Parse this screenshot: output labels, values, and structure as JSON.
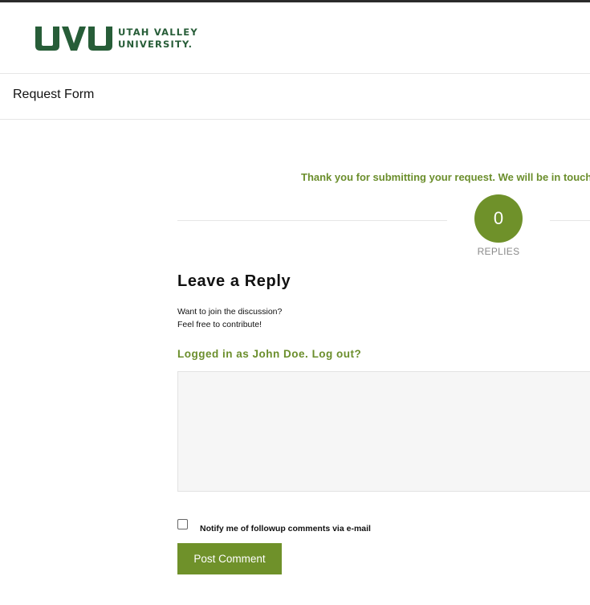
{
  "brand": {
    "logo_mark": "UVU",
    "logo_line1": "UTAH VALLEY",
    "logo_line2": "UNIVERSITY.",
    "color": "#275d38"
  },
  "page": {
    "title": "Request Form"
  },
  "main": {
    "thank_you": "Thank you for submitting your request. We will be in touch",
    "reply_count": "0",
    "reply_count_label": "REPLIES",
    "reply_heading": "Leave a Reply",
    "reply_desc_line1": "Want to join the discussion?",
    "reply_desc_line2": "Feel free to contribute!",
    "logged_prefix": "Logged in as",
    "logged_user": "John Doe",
    "logout_label": "Log out?",
    "comment_value": "",
    "notify_label": "Notify me of followup comments via e-mail",
    "notify_checked": false,
    "post_button": "Post Comment",
    "accent_color": "#6f912a"
  }
}
